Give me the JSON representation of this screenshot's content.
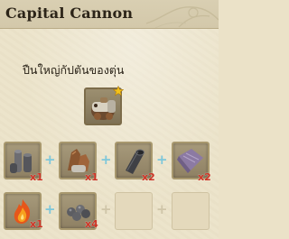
{
  "window": {
    "title": "Capital Cannon"
  },
  "subtitle": "ปืนใหญ่กัปตันของตุ่น",
  "result": {
    "icon": "cannon-creature-icon",
    "badge": "star-icon"
  },
  "row1": [
    {
      "icon": "stone-pillars-icon",
      "qty": "x1"
    },
    {
      "icon": "brown-ore-icon",
      "qty": "x1"
    },
    {
      "icon": "iron-pipe-icon",
      "qty": "x2"
    },
    {
      "icon": "purple-cloth-icon",
      "qty": "x2"
    }
  ],
  "row2": [
    {
      "icon": "fire-essence-icon",
      "qty": "x1"
    },
    {
      "icon": "iron-pellets-icon",
      "qty": "x4"
    }
  ],
  "plus": "+",
  "colors": {
    "qty": "#cc3324",
    "plus": "#7ec7da",
    "title": "#2c2418"
  }
}
